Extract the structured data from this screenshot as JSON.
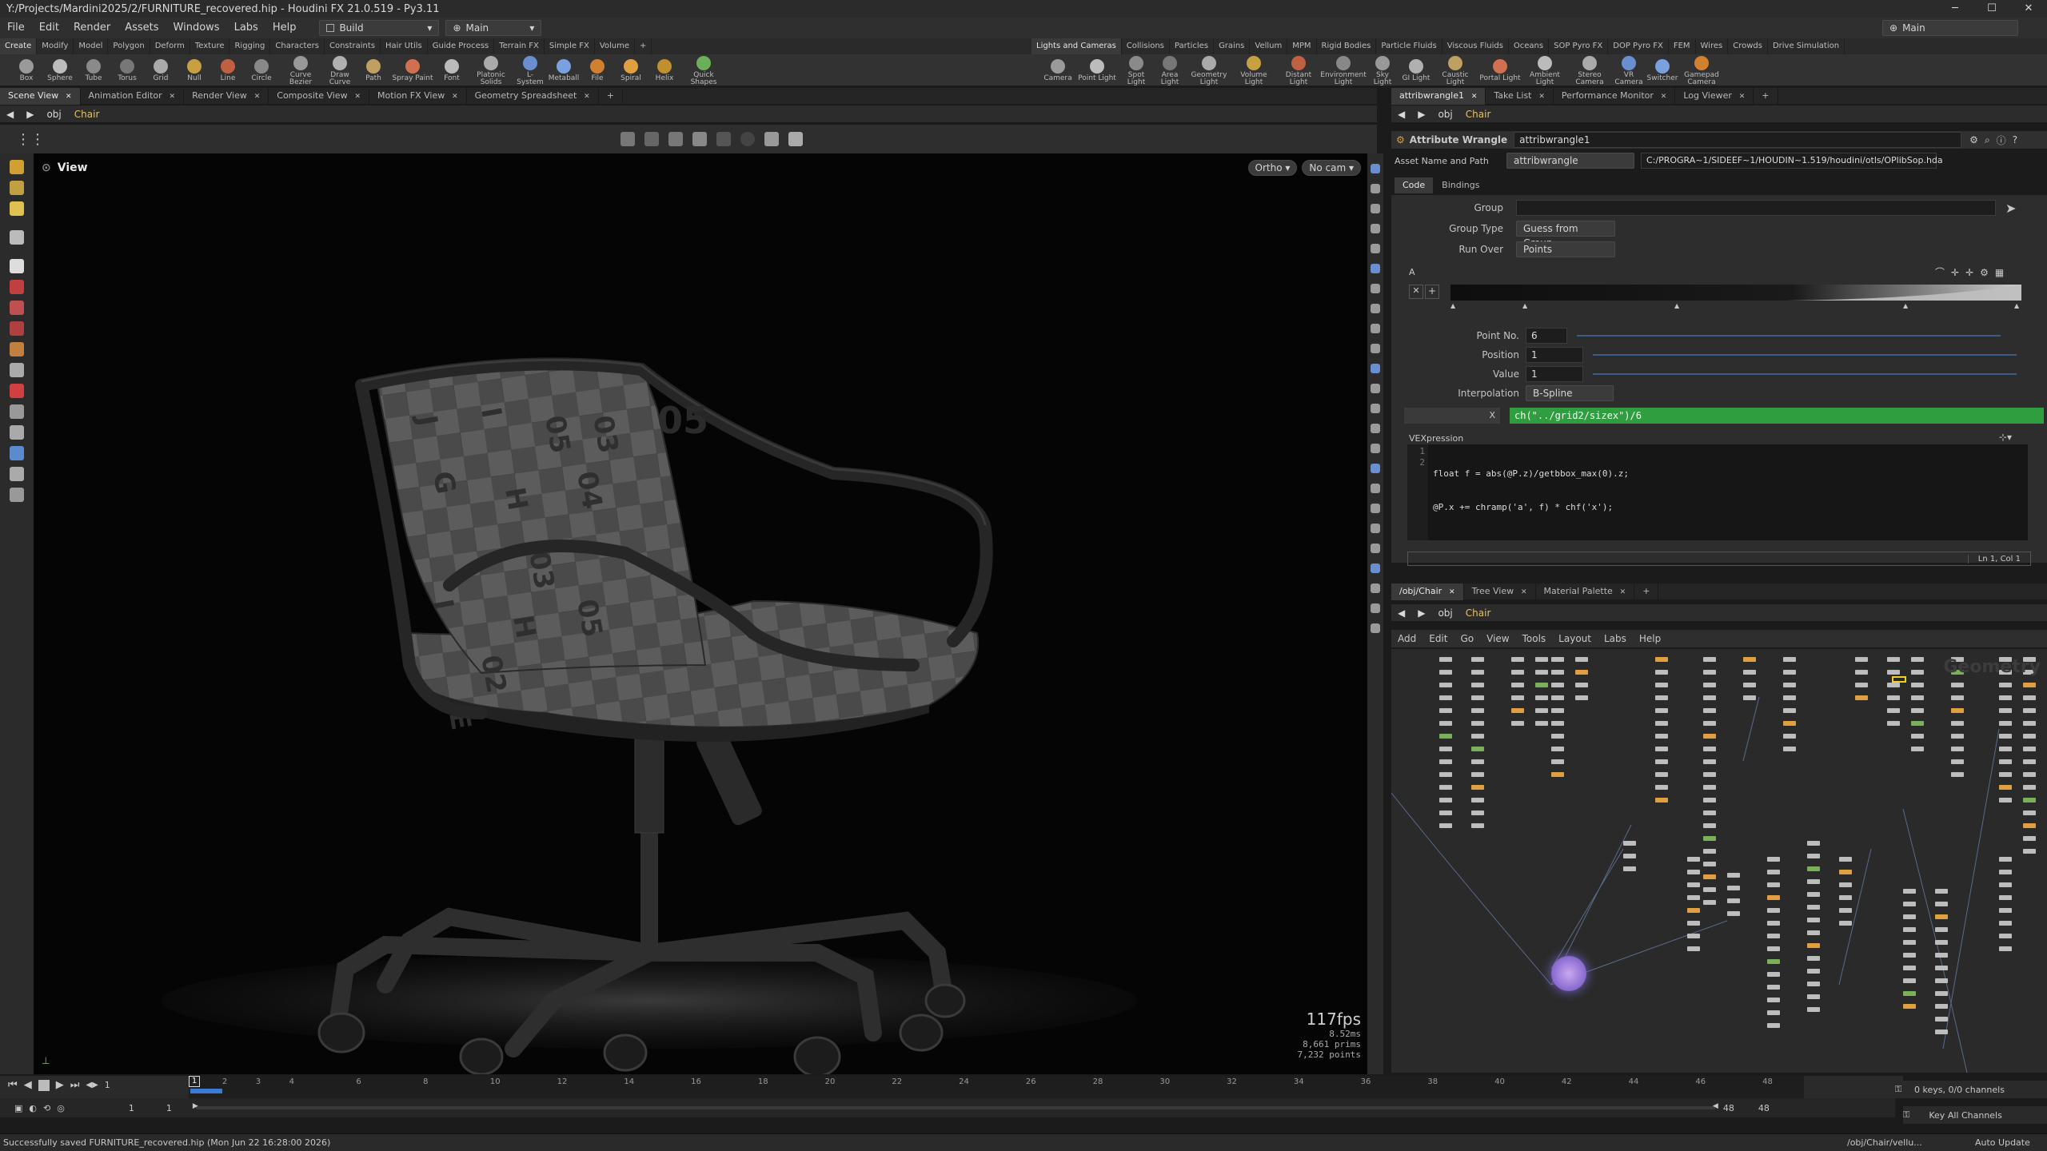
{
  "window": {
    "title": "Y:/Projects/Mardini2025/2/FURNITURE_recovered.hip - Houdini FX 21.0.519 - Py3.11",
    "min": "─",
    "max": "☐",
    "close": "✕"
  },
  "menu": {
    "items": [
      "File",
      "Edit",
      "Render",
      "Assets",
      "Windows",
      "Labs",
      "Help"
    ],
    "desktop": "Build",
    "main": "Main",
    "right_main": "Main"
  },
  "shelf_left": {
    "tabs": [
      "Create",
      "Modify",
      "Model",
      "Polygon",
      "Deform",
      "Texture",
      "Rigging",
      "Characters",
      "Constraints",
      "Hair Utils",
      "Guide Process",
      "Terrain FX",
      "Simple FX",
      "Volume"
    ],
    "tools": [
      "Box",
      "Sphere",
      "Tube",
      "Torus",
      "Grid",
      "Null",
      "Line",
      "Circle",
      "Curve Bezier",
      "Draw Curve",
      "Path",
      "Spray Paint",
      "Font",
      "Platonic Solids",
      "L-System",
      "Metaball",
      "File",
      "Spiral",
      "Helix",
      "Quick Shapes"
    ]
  },
  "shelf_right": {
    "tabs": [
      "Lights and Cameras",
      "Collisions",
      "Particles",
      "Grains",
      "Vellum",
      "MPM",
      "Rigid Bodies",
      "Particle Fluids",
      "Viscous Fluids",
      "Oceans",
      "SOP Pyro FX",
      "DOP Pyro FX",
      "FEM",
      "Wires",
      "Crowds",
      "Drive Simulation"
    ],
    "tools": [
      "Camera",
      "Point Light",
      "Spot Light",
      "Area Light",
      "Geometry Light",
      "Volume Light",
      "Distant Light",
      "Environment Light",
      "Sky Light",
      "GI Light",
      "Caustic Light",
      "Portal Light",
      "Ambient Light",
      "Stereo Camera",
      "VR Camera",
      "Switcher",
      "Gamepad Camera"
    ]
  },
  "left_pane": {
    "tabs": [
      "Scene View",
      "Animation Editor",
      "Render View",
      "Composite View",
      "Motion FX View",
      "Geometry Spreadsheet"
    ],
    "path": [
      "obj",
      "Chair"
    ]
  },
  "viewport": {
    "label": "View",
    "ortho": "Ortho ▾",
    "cam": "No cam ▾",
    "fps": "117fps",
    "ms": "8.52ms",
    "prims": "8,661  prims",
    "points": "7,232 points",
    "letters": [
      "J",
      "I",
      "05",
      "G",
      "H",
      "04",
      "05",
      "03",
      "J",
      "I",
      "H",
      "05",
      "02",
      "03",
      "E"
    ]
  },
  "param_pane": {
    "tabs": [
      "attribwrangle1",
      "Take List",
      "Performance Monitor",
      "Log Viewer"
    ],
    "path": [
      "obj",
      "Chair"
    ],
    "node_type": "Attribute Wrangle",
    "node_name": "attribwrangle1",
    "asset_label": "Asset Name and Path",
    "asset_name": "attribwrangle",
    "asset_path": "C:/PROGRA~1/SIDEEF~1/HOUDIN~1.519/houdini/otls/OPlibSop.hda",
    "subtabs": [
      "Code",
      "Bindings"
    ],
    "group_label": "Group",
    "group_value": "",
    "group_type_label": "Group Type",
    "group_type_value": "Guess from Group",
    "run_over_label": "Run Over",
    "run_over_value": "Points",
    "ramp_label": "A",
    "point_no_label": "Point No.",
    "point_no_value": "6",
    "position_label": "Position",
    "position_value": "1",
    "value_label": "Value",
    "value_value": "1",
    "interp_label": "Interpolation",
    "interp_value": "B-Spline",
    "x_label": "X",
    "x_expr": "ch(\"../grid2/sizex\")/6",
    "vex_label": "VEXpression",
    "code_lines": [
      "float f = abs(@P.z)/getbbox_max(0).z;",
      "@P.x += chramp('a', f) * chf('x');"
    ],
    "line_numbers": [
      "1",
      "2"
    ],
    "cursor_pos": "Ln 1, Col 1",
    "ramp_position": 0.16
  },
  "network_pane": {
    "tabs": [
      "/obj/Chair",
      "Tree View",
      "Material Palette"
    ],
    "path": [
      "obj",
      "Chair"
    ],
    "menu": [
      "Add",
      "Edit",
      "Go",
      "View",
      "Tools",
      "Layout",
      "Labs",
      "Help"
    ],
    "watermark": "Geometry"
  },
  "timeline": {
    "frames": [
      "1",
      "2",
      "3",
      "4",
      "6",
      "8",
      "10",
      "12",
      "14",
      "16",
      "18",
      "20",
      "22",
      "24",
      "26",
      "28",
      "30",
      "32",
      "34",
      "36",
      "38",
      "40",
      "42",
      "44",
      "46",
      "48"
    ],
    "current": "1",
    "start": "1",
    "start2": "1",
    "end": "48",
    "end2": "48",
    "keys": "0 keys, 0/0 channels",
    "key_all": "Key All Channels"
  },
  "status": {
    "message": "Successfully saved FURNITURE_recovered.hip (Mon Jun 22 16:28:00 2026)",
    "path": "/obj/Chair/vellu...",
    "update": "Auto Update"
  },
  "colors": {
    "accent": "#2f9e3e",
    "orange": "#e08a1e",
    "bg": "#1b1b1b",
    "viewport": "#050505"
  }
}
